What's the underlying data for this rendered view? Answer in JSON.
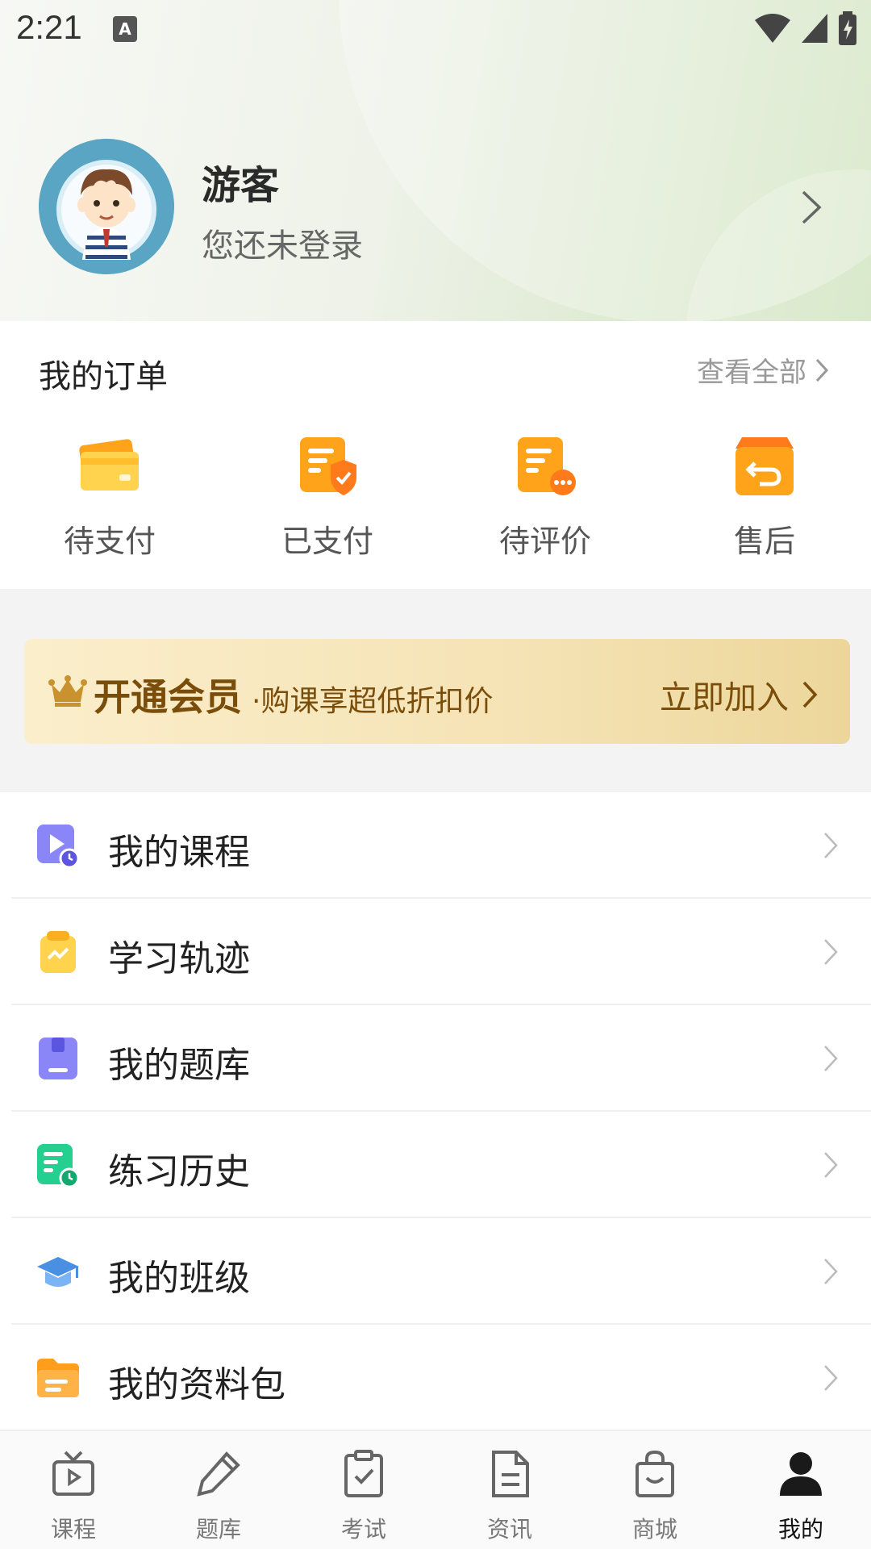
{
  "status_bar": {
    "time": "2:21",
    "notification_icon_letter": "A"
  },
  "profile": {
    "name": "游客",
    "subtitle": "您还未登录"
  },
  "orders": {
    "title": "我的订单",
    "view_all": "查看全部",
    "items": [
      {
        "label": "待支付",
        "icon": "wallet-icon"
      },
      {
        "label": "已支付",
        "icon": "paid-doc-icon"
      },
      {
        "label": "待评价",
        "icon": "comment-doc-icon"
      },
      {
        "label": "售后",
        "icon": "return-box-icon"
      }
    ]
  },
  "vip": {
    "title": "开通会员",
    "subtitle": "·购课享超低折扣价",
    "join": "立即加入"
  },
  "menu": [
    {
      "label": "我的课程",
      "icon": "course-play-icon",
      "color": "#8b86f7"
    },
    {
      "label": "学习轨迹",
      "icon": "study-trace-icon",
      "color": "#f9c226"
    },
    {
      "label": "我的题库",
      "icon": "question-bank-icon",
      "color": "#8b86f7"
    },
    {
      "label": "练习历史",
      "icon": "practice-history-icon",
      "color": "#25cf8f"
    },
    {
      "label": "我的班级",
      "icon": "class-cap-icon",
      "color": "#4a90e2"
    },
    {
      "label": "我的资料包",
      "icon": "material-folder-icon",
      "color": "#ff9d1c"
    }
  ],
  "tabs": [
    {
      "label": "课程",
      "icon": "tv-icon",
      "active": false
    },
    {
      "label": "题库",
      "icon": "pencil-icon",
      "active": false
    },
    {
      "label": "考试",
      "icon": "clipboard-check-icon",
      "active": false
    },
    {
      "label": "资讯",
      "icon": "document-icon",
      "active": false
    },
    {
      "label": "商城",
      "icon": "shopping-bag-icon",
      "active": false
    },
    {
      "label": "我的",
      "icon": "person-icon",
      "active": true
    }
  ],
  "colors": {
    "accent_orange": "#ffa31a",
    "vip_text": "#7a4e0a",
    "header_green": "#cfe3bd"
  }
}
